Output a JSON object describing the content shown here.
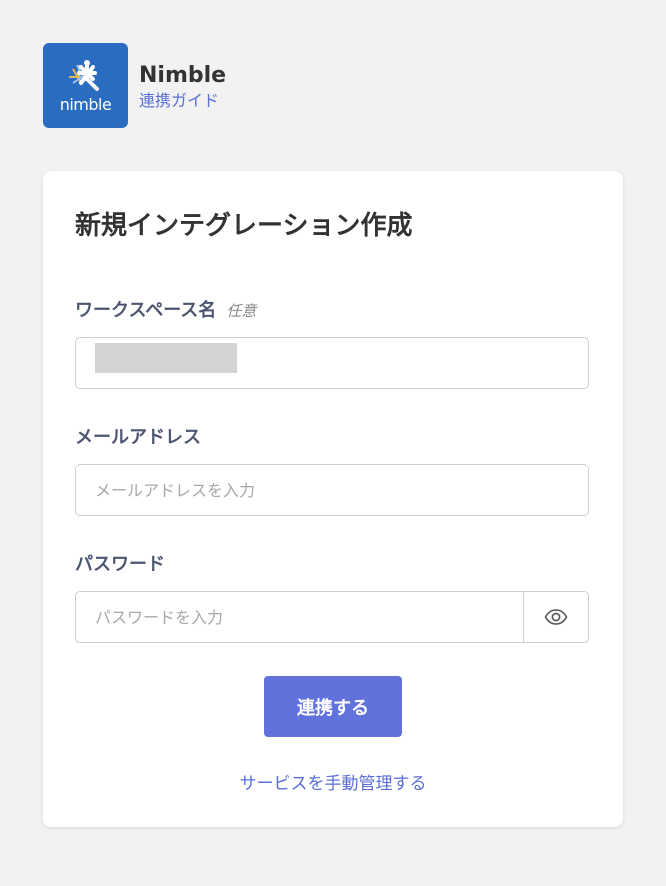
{
  "header": {
    "logo_icon": "nimble-logo-icon",
    "logo_text": "nimble",
    "app_name": "Nimble",
    "guide_link": "連携ガイド",
    "logo_color": "#2a6cc0"
  },
  "form": {
    "title": "新規インテグレーション作成",
    "workspace": {
      "label": "ワークスペース名",
      "optional": "任意",
      "value": ""
    },
    "email": {
      "label": "メールアドレス",
      "placeholder": "メールアドレスを入力",
      "value": ""
    },
    "password": {
      "label": "パスワード",
      "placeholder": "パスワードを入力",
      "value": "",
      "toggle_icon": "eye-icon"
    },
    "submit_label": "連携する",
    "manual_link": "サービスを手動管理する"
  },
  "colors": {
    "accent": "#6272dc",
    "link": "#5a6fd6",
    "background": "#f2f2f2"
  }
}
